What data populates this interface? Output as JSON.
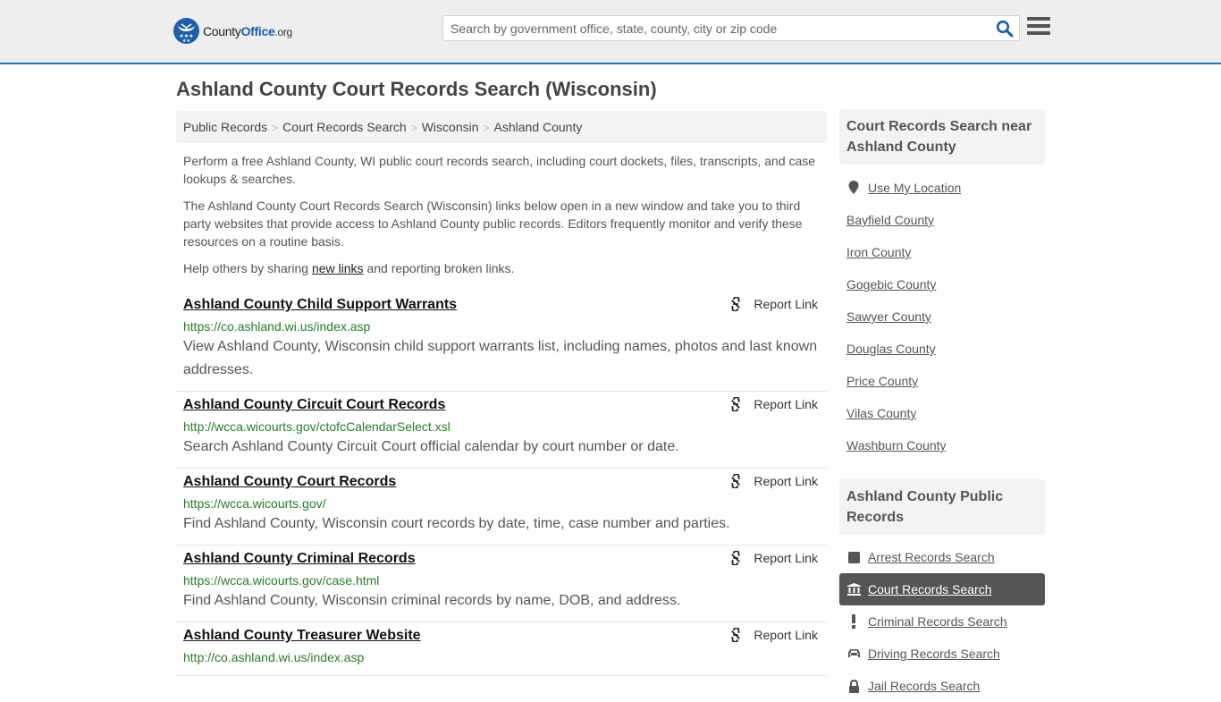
{
  "header": {
    "logo": {
      "name_part1": "County",
      "name_part2": "Office",
      "name_part3": ".org"
    },
    "search": {
      "placeholder": "Search by government office, state, county, city or zip code",
      "value": ""
    },
    "colors": {
      "accent": "#2c74b3",
      "brand": "#1f5ea8"
    }
  },
  "page": {
    "title": "Ashland County Court Records Search (Wisconsin)"
  },
  "breadcrumb": [
    {
      "label": "Public Records"
    },
    {
      "label": "Court Records Search"
    },
    {
      "label": "Wisconsin"
    },
    {
      "label": "Ashland County"
    }
  ],
  "intro": {
    "p1": "Perform a free Ashland County, WI public court records search, including court dockets, files, transcripts, and case lookups & searches.",
    "p2": "The Ashland County Court Records Search (Wisconsin) links below open in a new window and take you to third party websites that provide access to Ashland County public records. Editors frequently monitor and verify these resources on a routine basis.",
    "p3_before": "Help others by sharing ",
    "p3_link": "new links",
    "p3_after": " and reporting broken links."
  },
  "report_label": "Report Link",
  "results": [
    {
      "title": "Ashland County Child Support Warrants",
      "url": "https://co.ashland.wi.us/index.asp",
      "desc": "View Ashland County, Wisconsin child support warrants list, including names, photos and last known addresses."
    },
    {
      "title": "Ashland County Circuit Court Records",
      "url": "http://wcca.wicourts.gov/ctofcCalendarSelect.xsl",
      "desc": "Search Ashland County Circuit Court official calendar by court number or date."
    },
    {
      "title": "Ashland County Court Records",
      "url": "https://wcca.wicourts.gov/",
      "desc": "Find Ashland County, Wisconsin court records by date, time, case number and parties."
    },
    {
      "title": "Ashland County Criminal Records",
      "url": "https://wcca.wicourts.gov/case.html",
      "desc": "Find Ashland County, Wisconsin criminal records by name, DOB, and address."
    },
    {
      "title": "Ashland County Treasurer Website",
      "url": "http://co.ashland.wi.us/index.asp",
      "desc": ""
    }
  ],
  "sidebar": {
    "nearby": {
      "heading": "Court Records Search near Ashland County",
      "use_location": "Use My Location",
      "items": [
        "Bayfield County",
        "Iron County",
        "Gogebic County",
        "Sawyer County",
        "Douglas County",
        "Price County",
        "Vilas County",
        "Washburn County"
      ]
    },
    "public_records": {
      "heading": "Ashland County Public Records",
      "items": [
        {
          "label": "Arrest Records Search",
          "icon": "square-icon",
          "active": false
        },
        {
          "label": "Court Records Search",
          "icon": "courthouse-icon",
          "active": true
        },
        {
          "label": "Criminal Records Search",
          "icon": "exclamation-icon",
          "active": false
        },
        {
          "label": "Driving Records Search",
          "icon": "car-icon",
          "active": false
        },
        {
          "label": "Jail Records Search",
          "icon": "lock-icon",
          "active": false
        }
      ]
    }
  }
}
